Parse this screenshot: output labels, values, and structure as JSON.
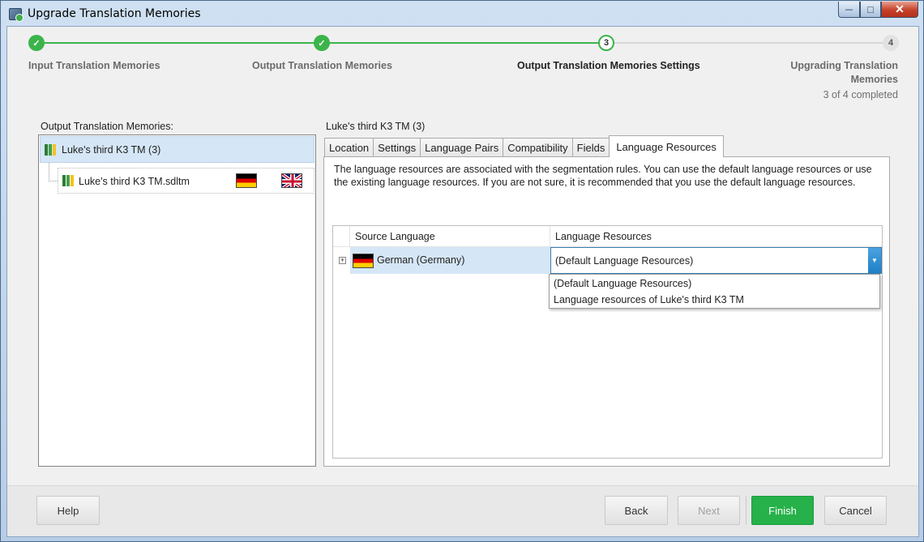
{
  "window": {
    "title": "Upgrade Translation Memories"
  },
  "stepper": {
    "steps": [
      {
        "number": "1",
        "label": "Input Translation Memories",
        "state": "done"
      },
      {
        "number": "2",
        "label": "Output Translation Memories",
        "state": "done"
      },
      {
        "number": "3",
        "label": "Output Translation Memories Settings",
        "state": "current"
      },
      {
        "number": "4",
        "label_line1": "Upgrading Translation",
        "label_line2": "Memories",
        "state": "todo"
      }
    ],
    "status": "3 of 4 completed",
    "colors": {
      "done": "#3cb44b",
      "todo": "#d7d7d7"
    }
  },
  "left_panel": {
    "caption": "Output Translation Memories:",
    "root_item": "Luke's third K3 TM (3)",
    "child_item": "Luke's third K3 TM.sdltm",
    "child_flags": [
      "flag-de",
      "flag-uk"
    ]
  },
  "right_panel": {
    "caption": "Luke's third K3 TM (3)",
    "tabs": [
      "Location",
      "Settings",
      "Language Pairs",
      "Compatibility",
      "Fields",
      "Language Resources"
    ],
    "active_tab": "Language Resources",
    "description": "The language resources are associated with the segmentation rules. You can use the default language resources or use the existing language resources. If you are not sure, it is recommended that you use the default language resources.",
    "grid": {
      "headers": [
        "Source Language",
        "Language Resources"
      ],
      "row": {
        "expander": "+",
        "source_language": "German (Germany)",
        "language_resources": "(Default Language Resources)"
      },
      "dropdown_options": [
        "(Default Language Resources)",
        "Language resources of Luke's third K3 TM"
      ]
    }
  },
  "footer": {
    "help": "Help",
    "back": "Back",
    "next": "Next",
    "finish": "Finish",
    "cancel": "Cancel",
    "accent": "#26b14a"
  }
}
